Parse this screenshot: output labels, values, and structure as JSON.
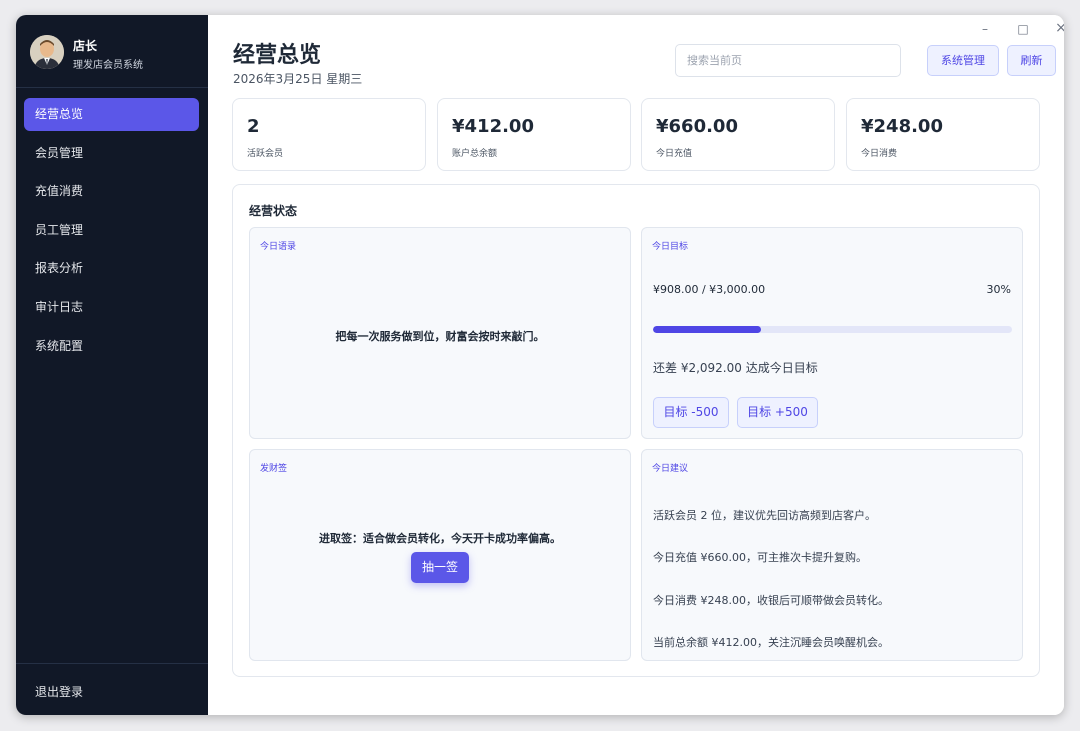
{
  "sidebar": {
    "user_name": "店长",
    "system_name": "理发店会员系统",
    "items": [
      {
        "label": "经营总览",
        "active": true
      },
      {
        "label": "会员管理"
      },
      {
        "label": "充值消费"
      },
      {
        "label": "员工管理"
      },
      {
        "label": "报表分析"
      },
      {
        "label": "审计日志"
      },
      {
        "label": "系统配置"
      }
    ],
    "logout": "退出登录"
  },
  "header": {
    "title": "经营总览",
    "date": "2026年3月25日 星期三",
    "search_placeholder": "搜索当前页",
    "system_btn": "系统管理",
    "refresh_btn": "刷新"
  },
  "window_controls": {
    "minimize": "–",
    "maximize": "□",
    "close": "×"
  },
  "stats": [
    {
      "value": "2",
      "label": "活跃会员"
    },
    {
      "value": "¥412.00",
      "label": "账户总余额"
    },
    {
      "value": "¥660.00",
      "label": "今日充值"
    },
    {
      "value": "¥248.00",
      "label": "今日消费"
    }
  ],
  "status": {
    "title": "经营状态",
    "quote": {
      "title": "今日语录",
      "text": "把每一次服务做到位，财富会按时来敲门。"
    },
    "goal": {
      "title": "今日目标",
      "amount": "¥908.00 / ¥3,000.00",
      "percent_label": "30%",
      "progress": 0.3,
      "remaining": "还差 ¥2,092.00 达成今日目标",
      "minus_btn": "目标 -500",
      "plus_btn": "目标 +500"
    },
    "fortune": {
      "title": "发财签",
      "text": "进取签：适合做会员转化，今天开卡成功率偏高。",
      "draw_btn": "抽一签"
    },
    "advice": {
      "title": "今日建议",
      "items": [
        "活跃会员 2 位，建议优先回访高频到店客户。",
        "今日充值 ¥660.00，可主推次卡提升复购。",
        "今日消费 ¥248.00，收银后可顺带做会员转化。",
        "当前总余额 ¥412.00，关注沉睡会员唤醒机会。"
      ]
    }
  },
  "colors": {
    "accent": "#5b57e8",
    "sidebar_bg": "#111827"
  }
}
